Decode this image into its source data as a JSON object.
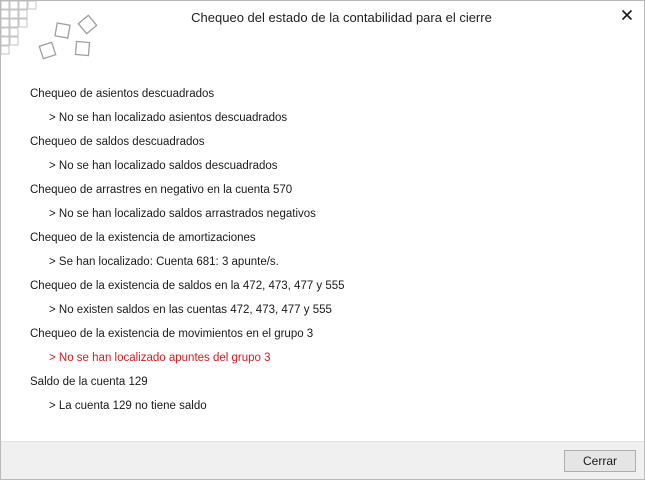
{
  "window": {
    "title": "Chequeo del estado de la contabilidad para el cierre",
    "close_icon": "close-icon"
  },
  "checks": [
    {
      "heading": "Chequeo de asientos descuadrados",
      "result": "> No se han localizado asientos descuadrados",
      "status": "ok"
    },
    {
      "heading": "Chequeo de saldos descuadrados",
      "result": "> No se han localizado saldos descuadrados",
      "status": "ok"
    },
    {
      "heading": "Chequeo de arrastres en negativo en la cuenta 570",
      "result": "> No se han localizado saldos arrastrados negativos",
      "status": "ok"
    },
    {
      "heading": "Chequeo de la existencia de amortizaciones",
      "result": "> Se han localizado: Cuenta 681: 3 apunte/s.",
      "status": "ok"
    },
    {
      "heading": "Chequeo de la existencia de saldos en la 472, 473, 477 y 555",
      "result": "> No existen saldos en las cuentas 472, 473, 477 y 555",
      "status": "ok"
    },
    {
      "heading": "Chequeo de la existencia de movimientos en el grupo 3",
      "result": "> No se han localizado apuntes del grupo 3",
      "status": "error"
    },
    {
      "heading": "Saldo de la cuenta 129",
      "result": "> La cuenta 129 no tiene saldo",
      "status": "ok"
    }
  ],
  "colors": {
    "error": "#e0161a",
    "text": "#1a1a1a"
  },
  "footer": {
    "close_button_label": "Cerrar"
  }
}
